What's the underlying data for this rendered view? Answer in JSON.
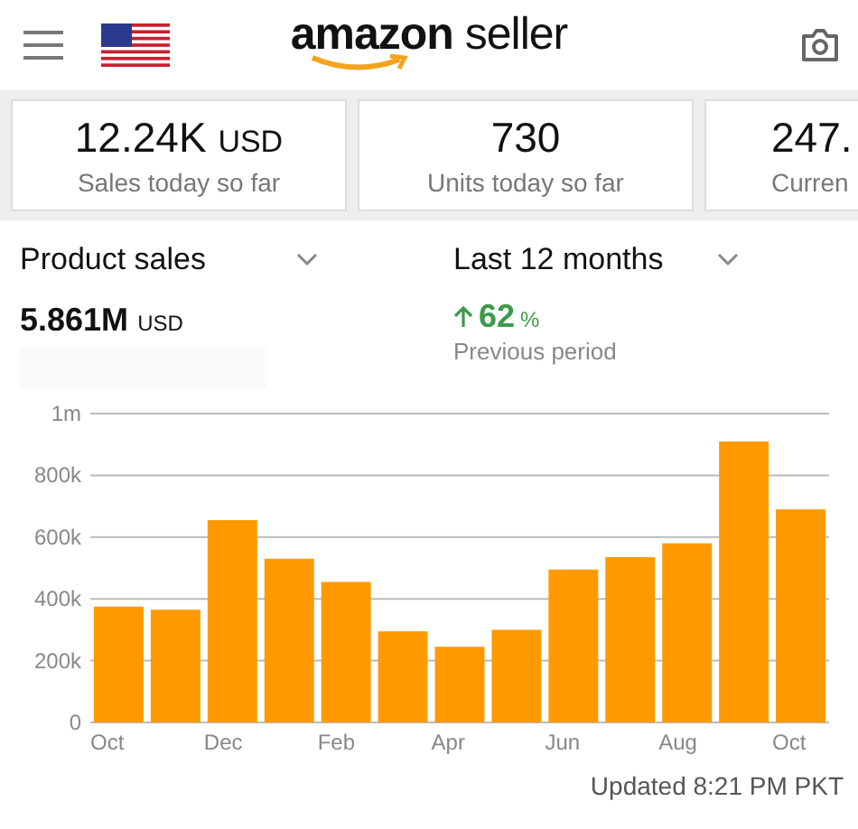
{
  "header": {
    "logo_brand": "amazon",
    "logo_product": "seller"
  },
  "metrics": [
    {
      "value": "12.24K",
      "unit": "USD",
      "label": "Sales today so far"
    },
    {
      "value": "730",
      "label": "Units today so far"
    },
    {
      "value": "247.",
      "label": "Curren"
    }
  ],
  "metric_select": {
    "label": "Product sales"
  },
  "period_select": {
    "label": "Last 12 months"
  },
  "total": {
    "value": "5.861M",
    "unit": "USD"
  },
  "change": {
    "value": "62",
    "unit": "%",
    "label": "Previous period"
  },
  "chart": {
    "chart_data": {
      "type": "bar",
      "grid": true,
      "categories": [
        "Oct",
        null,
        "Dec",
        null,
        "Feb",
        null,
        "Apr",
        null,
        "Jun",
        null,
        "Aug",
        null,
        "Oct"
      ],
      "series": [
        {
          "color": "#ff9900",
          "values": [
            375000,
            365000,
            655000,
            530000,
            455000,
            295000,
            245000,
            300000,
            495000,
            535000,
            580000,
            910000,
            690000
          ]
        }
      ],
      "ylim": [
        0,
        1000000
      ],
      "yticks": [
        {
          "value": 0,
          "label": "0"
        },
        {
          "value": 200000,
          "label": "200k"
        },
        {
          "value": 400000,
          "label": "400k"
        },
        {
          "value": 600000,
          "label": "600k"
        },
        {
          "value": 800000,
          "label": "800k"
        },
        {
          "value": 1000000,
          "label": "1m"
        }
      ]
    }
  },
  "footer": {
    "updated": "Updated 8:21 PM PKT"
  }
}
